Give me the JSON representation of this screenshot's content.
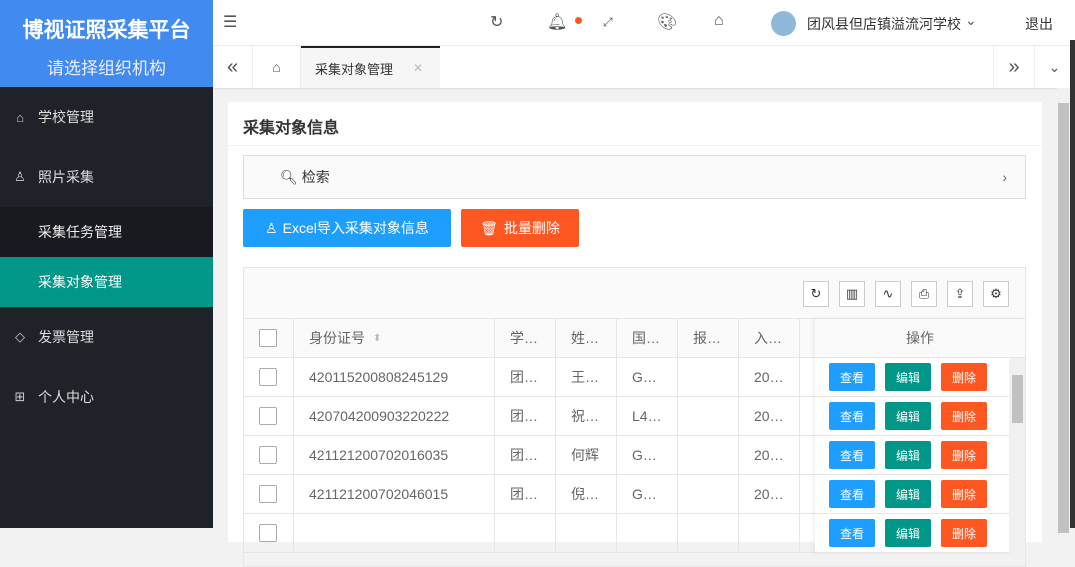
{
  "brand": {
    "title": "博视证照采集平台",
    "subtitle": "请选择组织机构"
  },
  "sidebar": {
    "items": [
      {
        "label": "学校管理",
        "icon": "home-icon"
      },
      {
        "label": "照片采集",
        "icon": "user-icon"
      },
      {
        "label": "发票管理",
        "icon": "tag-icon"
      },
      {
        "label": "个人中心",
        "icon": "apps-icon"
      }
    ],
    "subitems": [
      {
        "label": "采集任务管理"
      },
      {
        "label": "采集对象管理",
        "active": true
      }
    ]
  },
  "header": {
    "user": "团风县但店镇溢流河学校",
    "logout": "退出"
  },
  "tabs": {
    "current": "采集对象管理"
  },
  "card": {
    "title": "采集对象信息",
    "search_label": "检索",
    "import_btn": "Excel导入采集对象信息",
    "delete_btn": "批量删除"
  },
  "table": {
    "columns": [
      "身份证号",
      "学…",
      "姓…",
      "国…",
      "报…",
      "入…"
    ],
    "action_header": "操作",
    "rows": [
      {
        "id": "420115200808245129",
        "c1": "团…",
        "c2": "王…",
        "c3": "G…",
        "c4": "",
        "c5": "20…"
      },
      {
        "id": "420704200903220222",
        "c1": "团…",
        "c2": "祝…",
        "c3": "L4…",
        "c4": "",
        "c5": "20…"
      },
      {
        "id": "421121200702016035",
        "c1": "团…",
        "c2": "何辉",
        "c3": "G…",
        "c4": "",
        "c5": "20…"
      },
      {
        "id": "421121200702046015",
        "c1": "团…",
        "c2": "倪…",
        "c3": "G…",
        "c4": "",
        "c5": "20…"
      }
    ],
    "actions": {
      "view": "查看",
      "edit": "编辑",
      "delete": "删除"
    }
  },
  "colors": {
    "primary": "#1e9fff",
    "teal": "#009688",
    "orange": "#ff5722",
    "brand": "#418bf0"
  }
}
